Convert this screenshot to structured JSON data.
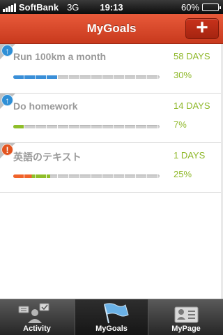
{
  "status": {
    "carrier": "SoftBank",
    "network": "3G",
    "time": "19:13",
    "battery": "60%",
    "battery_level": 0.6
  },
  "nav": {
    "title": "MyGoals",
    "add_label": "+"
  },
  "goals": [
    {
      "title": "Run 100km a month",
      "days": "58 DAYS",
      "percent": "30%",
      "progress": 0.3,
      "badge": "up-arrow-icon",
      "badge_glyph": "↑",
      "bar_color": "#3a8fd8"
    },
    {
      "title": "Do homework",
      "days": "14 DAYS",
      "percent": "7%",
      "progress": 0.07,
      "badge": "up-arrow-icon",
      "badge_glyph": "↑",
      "bar_color": "#8fbe2a"
    },
    {
      "title": "英語のテキスト",
      "days": "1 DAYS",
      "percent": "25%",
      "progress": 0.25,
      "badge": "exclamation-icon",
      "badge_glyph": "!",
      "bar_color": "#f0632a",
      "bar_color2": "#8fbe2a"
    }
  ],
  "tabs": [
    {
      "label": "Activity",
      "icon": "activity-icon",
      "active": false
    },
    {
      "label": "MyGoals",
      "icon": "flag-icon",
      "active": true
    },
    {
      "label": "MyPage",
      "icon": "profile-card-icon",
      "active": false
    }
  ],
  "colors": {
    "nav": "#d9462a",
    "accent_green": "#8fb82a",
    "accent_blue": "#2f8fd6"
  }
}
